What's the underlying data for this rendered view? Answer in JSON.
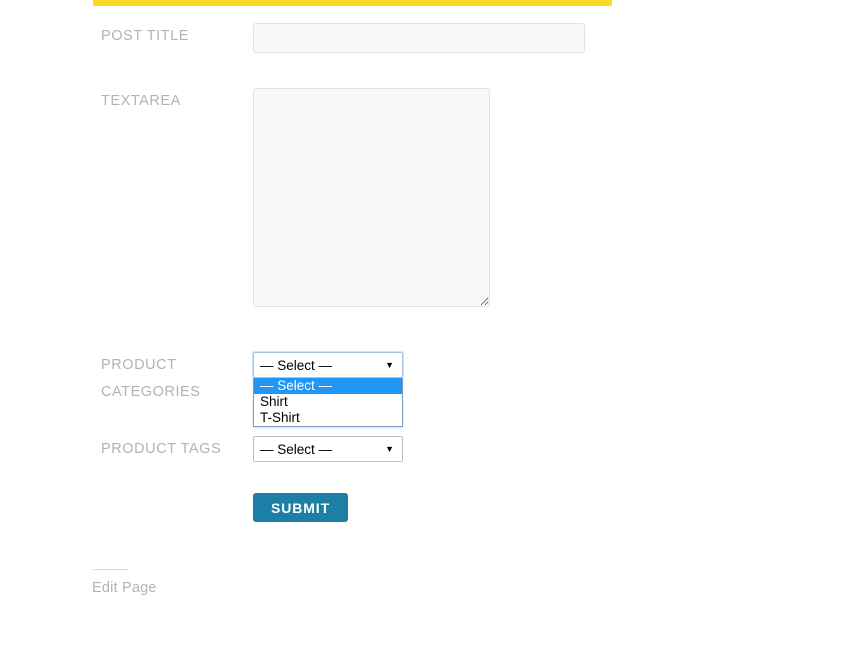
{
  "theme": {
    "accent_bar_color": "#fada20",
    "submit_button_color": "#1b7fa6",
    "dropdown_highlight_color": "#2196f3",
    "label_color": "#b3b3b3",
    "input_background": "#f8f8f8"
  },
  "progress": {
    "value_percent": 100
  },
  "form": {
    "fields": {
      "post_title": {
        "label": "Post Title",
        "value": "",
        "placeholder": ""
      },
      "textarea": {
        "label": "Textarea",
        "value": "",
        "placeholder": ""
      },
      "product_categories": {
        "label": "Product Categories",
        "selected": "— Select —",
        "open": true,
        "options": [
          {
            "label": "— Select —",
            "selected": true
          },
          {
            "label": "Shirt",
            "selected": false
          },
          {
            "label": "T-Shirt",
            "selected": false
          }
        ]
      },
      "product_tags": {
        "label": "Product Tags",
        "selected": "— Select —",
        "open": false,
        "options": [
          {
            "label": "— Select —",
            "selected": true
          }
        ]
      }
    },
    "submit_label": "Submit"
  },
  "footer": {
    "edit_page_label": "Edit Page"
  },
  "icons": {
    "dropdown_arrow": "▼"
  }
}
